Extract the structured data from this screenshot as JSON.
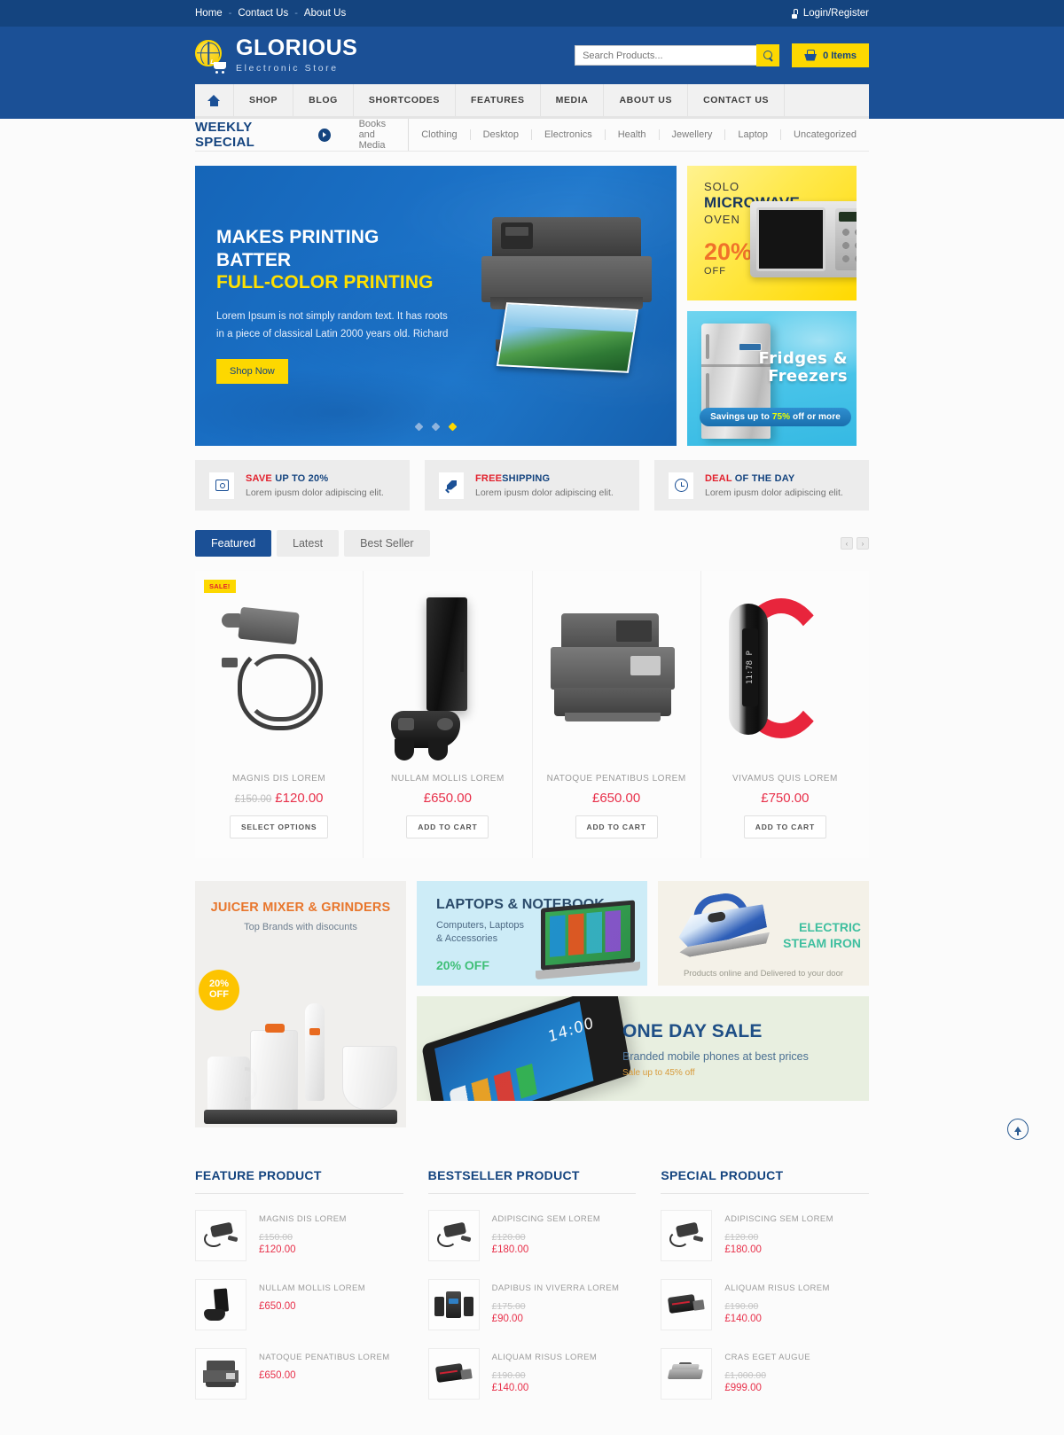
{
  "topbar": {
    "links": [
      "Home",
      "Contact Us",
      "About Us"
    ],
    "separator": "-",
    "account": "Login/Register"
  },
  "header": {
    "brand_name": "GLORIOUS",
    "brand_tagline": "Electronic Store",
    "search_placeholder": "Search Products...",
    "cart_label": "0 Items"
  },
  "nav": {
    "home_icon": "home-icon",
    "items": [
      "SHOP",
      "BLOG",
      "SHORTCODES",
      "FEATURES",
      "MEDIA",
      "ABOUT US",
      "CONTACT US"
    ]
  },
  "weekly": {
    "title": "WEEKLY SPECIAL",
    "categories": [
      "Books and Media",
      "Clothing",
      "Desktop",
      "Electronics",
      "Health",
      "Jewellery",
      "Laptop",
      "Uncategorized"
    ]
  },
  "hero": {
    "headline_1": "MAKES PRINTING BATTER",
    "headline_2": "FULL-COLOR PRINTING",
    "body": "Lorem Ipsum is not simply random text. It has roots in a piece of classical Latin 2000 years old. Richard",
    "cta": "Shop Now",
    "slides": 3,
    "active_slide": 3
  },
  "promo_microwave": {
    "line1": "SOLO",
    "line2": "MICROWAVE",
    "line3": "OVEN",
    "percent": "20%",
    "off": "OFF"
  },
  "promo_fridge": {
    "title": "Fridges & Freezers",
    "savings_prefix": "Savings up to ",
    "savings_highlight": "75%",
    "savings_suffix": " off or more"
  },
  "features": [
    {
      "title_strong": "SAVE",
      "title_rest": " UP TO 20%",
      "subtitle": "Lorem ipusm dolor adipiscing elit.",
      "icon": "money-icon"
    },
    {
      "title_strong": "FREE",
      "title_rest": "SHIPPING",
      "subtitle": "Lorem ipusm dolor adipiscing elit.",
      "icon": "rocket-icon"
    },
    {
      "title_strong": "DEAL",
      "title_rest": " OF THE DAY",
      "subtitle": "Lorem ipusm dolor adipiscing elit.",
      "icon": "clock-icon"
    }
  ],
  "tabs": {
    "items": [
      "Featured",
      "Latest",
      "Best Seller"
    ],
    "active": "Featured",
    "prev_icon": "chevron-left-icon",
    "next_icon": "chevron-right-icon",
    "prev_glyph": "‹",
    "next_glyph": "›"
  },
  "products": [
    {
      "name": "MAGNIS DIS LOREM",
      "old_price": "£150.00",
      "price": "£120.00",
      "button": "SELECT OPTIONS",
      "badge": "SALE!",
      "image": "car-charger"
    },
    {
      "name": "NULLAM MOLLIS LOREM",
      "old_price": "",
      "price": "£650.00",
      "button": "ADD TO CART",
      "badge": "",
      "image": "game-console"
    },
    {
      "name": "NATOQUE PENATIBUS LOREM",
      "old_price": "",
      "price": "£650.00",
      "button": "ADD TO CART",
      "badge": "",
      "image": "printer"
    },
    {
      "name": "VIVAMUS QUIS LOREM",
      "old_price": "",
      "price": "£750.00",
      "button": "ADD TO CART",
      "badge": "",
      "image": "smart-watch"
    }
  ],
  "banner_juicer": {
    "title": "JUICER MIXER & GRINDERS",
    "subtitle": "Top Brands with disocunts",
    "badge_percent": "20%",
    "badge_off": "OFF"
  },
  "banner_laptops": {
    "title": "LAPTOPS & NOTEBOOK",
    "subtitle": "Computers, Laptops\n& Accessories",
    "subtitle_line1": "Computers, Laptops",
    "subtitle_line2": "& Accessories",
    "offer": "20% OFF"
  },
  "banner_iron": {
    "title_line1": "ELECTRIC",
    "title_line2": "STEAM IRON",
    "subtitle": "Products online and Delivered to your door"
  },
  "banner_oneday": {
    "title": "ONE DAY SALE",
    "subtitle": "Branded mobile phones at best prices",
    "note": "Sale up to 45% off",
    "phone_time": "14:00"
  },
  "lists": [
    {
      "heading": "FEATURE PRODUCT",
      "items": [
        {
          "name": "MAGNIS DIS LOREM",
          "old_price": "£150.00",
          "price": "£120.00",
          "image": "charger-thumb"
        },
        {
          "name": "NULLAM MOLLIS LOREM",
          "old_price": "",
          "price": "£650.00",
          "image": "console-thumb"
        },
        {
          "name": "NATOQUE PENATIBUS LOREM",
          "old_price": "",
          "price": "£650.00",
          "image": "printer-thumb"
        }
      ]
    },
    {
      "heading": "BESTSELLER PRODUCT",
      "items": [
        {
          "name": "ADIPISCING SEM LOREM",
          "old_price": "£120.00",
          "price": "£180.00",
          "image": "charger-thumb"
        },
        {
          "name": "DAPIBUS IN VIVERRA LOREM",
          "old_price": "£175.00",
          "price": "£90.00",
          "image": "speaker-thumb"
        },
        {
          "name": "ALIQUAM RISUS LOREM",
          "old_price": "£190.00",
          "price": "£140.00",
          "image": "usb-thumb"
        }
      ]
    },
    {
      "heading": "SPECIAL PRODUCT",
      "items": [
        {
          "name": "ADIPISCING SEM LOREM",
          "old_price": "£120.00",
          "price": "£180.00",
          "image": "charger-thumb"
        },
        {
          "name": "ALIQUAM RISUS LOREM",
          "old_price": "£190.00",
          "price": "£140.00",
          "image": "usb-thumb"
        },
        {
          "name": "CRAS EGET AUGUE",
          "old_price": "£1,000.00",
          "price": "£999.00",
          "image": "grill-thumb"
        }
      ]
    }
  ],
  "scroll_top": {
    "icon": "arrow-up-icon"
  },
  "colors": {
    "brand_blue": "#1b5096",
    "dark_blue": "#14447f",
    "yellow": "#fdd800",
    "price_red": "#e8304a",
    "accent_red": "#e2222e"
  }
}
